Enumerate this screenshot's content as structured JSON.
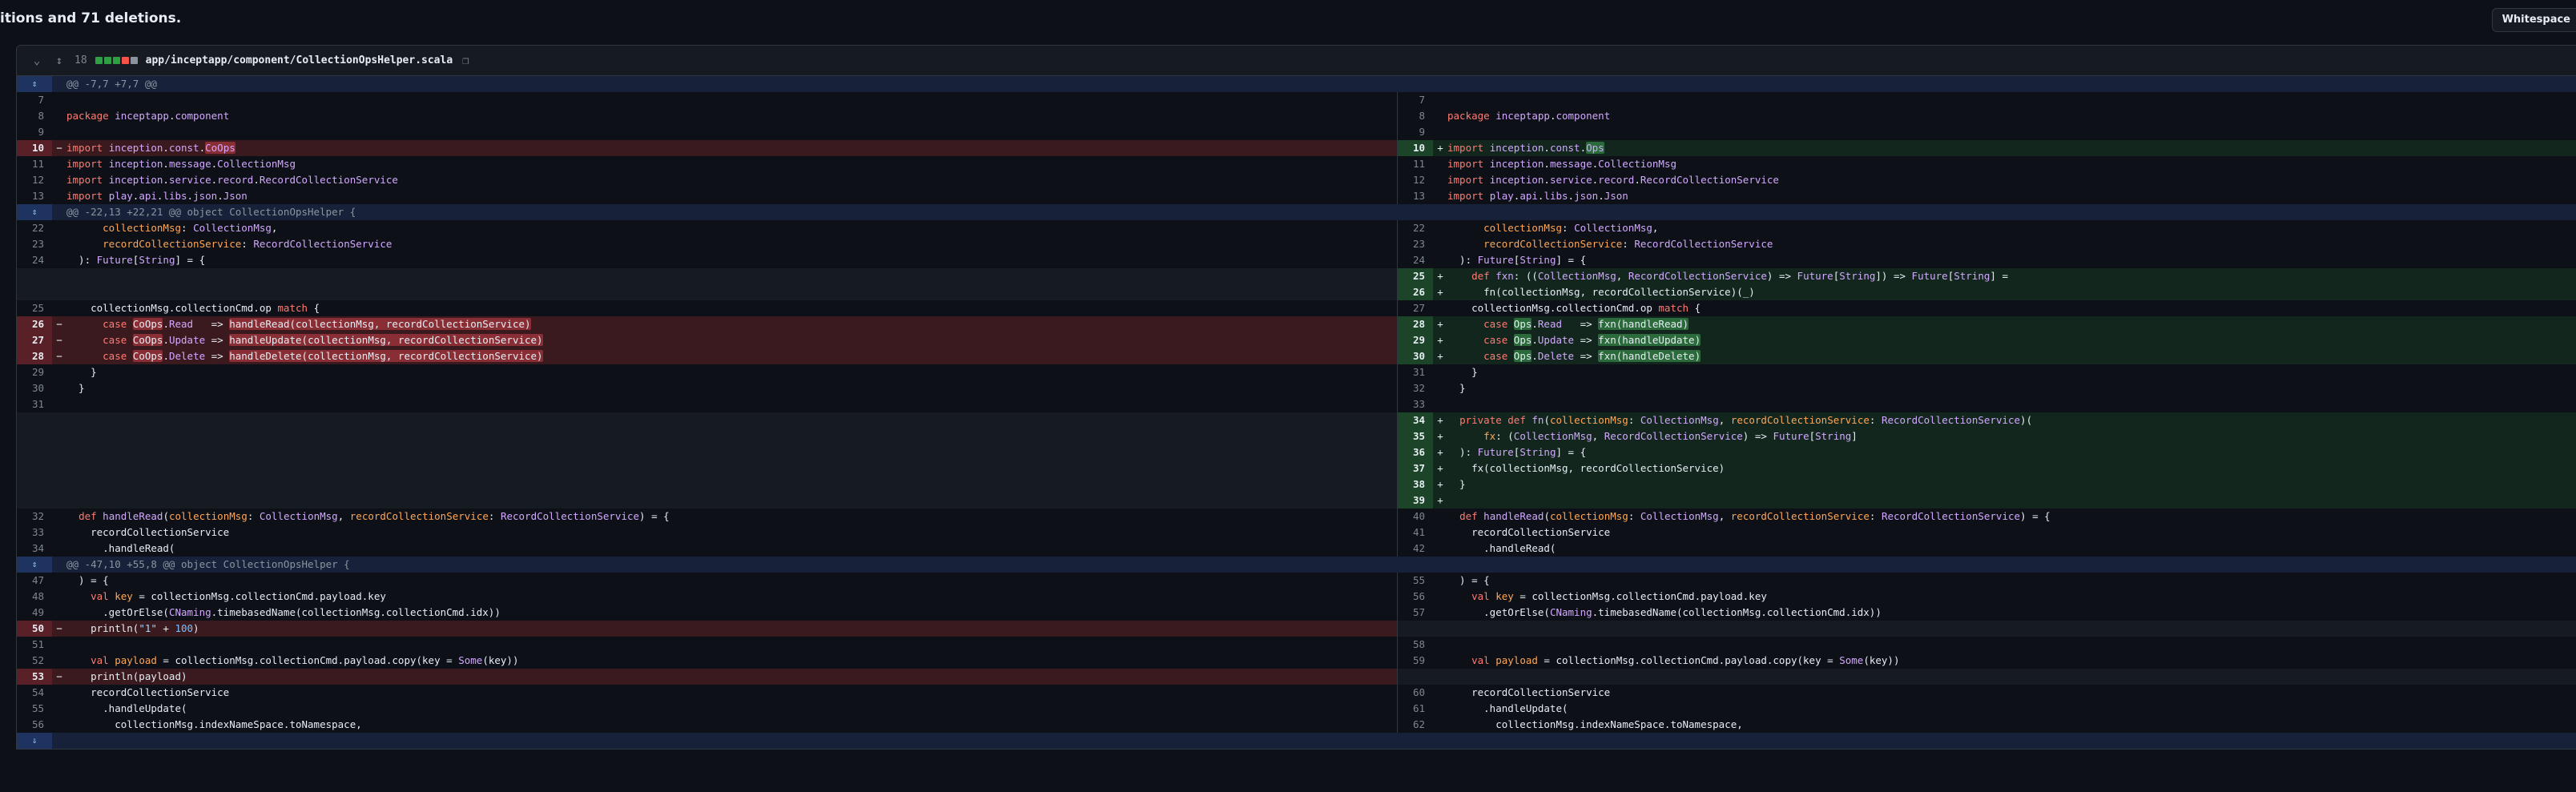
{
  "summary": "itions and 71 deletions.",
  "whitespace_button": "Whitespace",
  "file": {
    "change_count": "18",
    "path": "app/inceptapp/component/CollectionOpsHelper.scala",
    "bar_colors": [
      "#2ea043",
      "#2ea043",
      "#2ea043",
      "#f85149",
      "#8b949e"
    ]
  },
  "icons": {
    "chevron": "chevron-down-icon",
    "expand": "unfold-icon",
    "copy": "copy-icon"
  },
  "hunks": [
    "@@ -7,7 +7,7 @@",
    "@@ -22,13 +22,21 @@ object CollectionOpsHelper {",
    "@@ -47,10 +55,8 @@ object CollectionOpsHelper {"
  ],
  "rows": [
    {
      "t": "hunk",
      "h": 0
    },
    {
      "t": "n",
      "l": "7",
      "r": "7",
      "c": ""
    },
    {
      "t": "n",
      "l": "8",
      "r": "8",
      "c": "<span class='kw'>package</span> <span class='ty'>inceptapp</span>.<span class='ty'>component</span>"
    },
    {
      "t": "n",
      "l": "9",
      "r": "9",
      "c": ""
    },
    {
      "t": "dl",
      "l": "10",
      "r": "10",
      "lc": "<span class='kw'>import</span> <span class='ty'>inception</span>.<span class='ty'>const</span>.<span class='hd ty'>CoOps</span>",
      "rc": "<span class='kw'>import</span> <span class='ty'>inception</span>.<span class='ty'>const</span>.<span class='ha ty'>Ops</span>"
    },
    {
      "t": "n",
      "l": "11",
      "r": "11",
      "c": "<span class='kw'>import</span> <span class='ty'>inception</span>.<span class='ty'>message</span>.<span class='ty'>CollectionMsg</span>"
    },
    {
      "t": "n",
      "l": "12",
      "r": "12",
      "c": "<span class='kw'>import</span> <span class='ty'>inception</span>.<span class='ty'>service</span>.<span class='ty'>record</span>.<span class='ty'>RecordCollectionService</span>"
    },
    {
      "t": "n",
      "l": "13",
      "r": "13",
      "c": "<span class='kw'>import</span> <span class='ty'>play</span>.<span class='ty'>api</span>.<span class='ty'>libs</span>.<span class='ty'>json</span>.<span class='ty'>Json</span>"
    },
    {
      "t": "hunk",
      "h": 1
    },
    {
      "t": "n",
      "l": "22",
      "r": "22",
      "c": "      <span class='pm'>collectionMsg</span>: <span class='ty'>CollectionMsg</span>,"
    },
    {
      "t": "n",
      "l": "23",
      "r": "23",
      "c": "      <span class='pm'>recordCollectionService</span>: <span class='ty'>RecordCollectionService</span>"
    },
    {
      "t": "n",
      "l": "24",
      "r": "24",
      "c": "  ): <span class='ty'>Future</span>[<span class='ty'>String</span>] = {"
    },
    {
      "t": "ar",
      "r": "25",
      "rc": "    <span class='kw'>def</span> <span class='fn'>fxn</span>: ((<span class='ty'>CollectionMsg</span>, <span class='ty'>RecordCollectionService</span>) => <span class='ty'>Future</span>[<span class='ty'>String</span>]) => <span class='ty'>Future</span>[<span class='ty'>String</span>] ="
    },
    {
      "t": "ar",
      "r": "26",
      "rc": "      fn(collectionMsg, recordCollectionService)(_)"
    },
    {
      "t": "n",
      "l": "25",
      "r": "27",
      "c": "    collectionMsg.collectionCmd.op <span class='kw'>match</span> {"
    },
    {
      "t": "dl",
      "l": "26",
      "r": "28",
      "lc": "      <span class='kw'>case</span> <span class='hd'>CoOps</span>.<span class='ty'>Read</span>   => <span class='hd'>handleRead(collectionMsg, recordCollectionService)</span>",
      "rc": "      <span class='kw'>case</span> <span class='ha'>Ops</span>.<span class='ty'>Read</span>   => <span class='ha'>fxn(handleRead)</span>"
    },
    {
      "t": "dl",
      "l": "27",
      "r": "29",
      "lc": "      <span class='kw'>case</span> <span class='hd'>CoOps</span>.<span class='ty'>Update</span> => <span class='hd'>handleUpdate(collectionMsg, recordCollectionService)</span>",
      "rc": "      <span class='kw'>case</span> <span class='ha'>Ops</span>.<span class='ty'>Update</span> => <span class='ha'>fxn(handleUpdate)</span>"
    },
    {
      "t": "dl",
      "l": "28",
      "r": "30",
      "lc": "      <span class='kw'>case</span> <span class='hd'>CoOps</span>.<span class='ty'>Delete</span> => <span class='hd'>handleDelete(collectionMsg, recordCollectionService)</span>",
      "rc": "      <span class='kw'>case</span> <span class='ha'>Ops</span>.<span class='ty'>Delete</span> => <span class='ha'>fxn(handleDelete)</span>"
    },
    {
      "t": "n",
      "l": "29",
      "r": "31",
      "c": "    }"
    },
    {
      "t": "n",
      "l": "30",
      "r": "32",
      "c": "  }"
    },
    {
      "t": "n",
      "l": "31",
      "r": "33",
      "c": ""
    },
    {
      "t": "ar",
      "r": "34",
      "rc": "  <span class='kw'>private</span> <span class='kw'>def</span> <span class='fn'>fn</span>(<span class='pm'>collectionMsg</span>: <span class='ty'>CollectionMsg</span>, <span class='pm'>recordCollectionService</span>: <span class='ty'>RecordCollectionService</span>)("
    },
    {
      "t": "ar",
      "r": "35",
      "rc": "      <span class='pm'>fx</span>: (<span class='ty'>CollectionMsg</span>, <span class='ty'>RecordCollectionService</span>) => <span class='ty'>Future</span>[<span class='ty'>String</span>]"
    },
    {
      "t": "ar",
      "r": "36",
      "rc": "  ): <span class='ty'>Future</span>[<span class='ty'>String</span>] = {"
    },
    {
      "t": "ar",
      "r": "37",
      "rc": "    fx(collectionMsg, recordCollectionService)"
    },
    {
      "t": "ar",
      "r": "38",
      "rc": "  }"
    },
    {
      "t": "ar",
      "r": "39",
      "rc": ""
    },
    {
      "t": "n",
      "l": "32",
      "r": "40",
      "c": "  <span class='kw'>def</span> <span class='fn'>handleRead</span>(<span class='pm'>collectionMsg</span>: <span class='ty'>CollectionMsg</span>, <span class='pm'>recordCollectionService</span>: <span class='ty'>RecordCollectionService</span>) = {"
    },
    {
      "t": "n",
      "l": "33",
      "r": "41",
      "c": "    recordCollectionService"
    },
    {
      "t": "n",
      "l": "34",
      "r": "42",
      "c": "      .handleRead("
    },
    {
      "t": "hunk",
      "h": 2
    },
    {
      "t": "n",
      "l": "47",
      "r": "55",
      "c": "  ) = {"
    },
    {
      "t": "n",
      "l": "48",
      "r": "56",
      "c": "    <span class='kw'>val</span> <span class='pm'>key</span> = collectionMsg.collectionCmd.payload.key"
    },
    {
      "t": "n",
      "l": "49",
      "r": "57",
      "c": "      .getOrElse(<span class='ty'>CNaming</span>.timebasedName(collectionMsg.collectionCmd.idx))"
    },
    {
      "t": "dl",
      "l": "50",
      "lc": "    println(<span class='st'>\"1\"</span> + <span class='nu'>100</span>)",
      "rc": ""
    },
    {
      "t": "n",
      "l": "51",
      "r": "58",
      "c": ""
    },
    {
      "t": "n",
      "l": "52",
      "r": "59",
      "c": "    <span class='kw'>val</span> <span class='pm'>payload</span> = collectionMsg.collectionCmd.payload.copy(key = <span class='ty'>Some</span>(key))"
    },
    {
      "t": "dl",
      "l": "53",
      "lc": "    println(payload)",
      "rc": ""
    },
    {
      "t": "n",
      "l": "54",
      "r": "60",
      "c": "    recordCollectionService"
    },
    {
      "t": "n",
      "l": "55",
      "r": "61",
      "c": "      .handleUpdate("
    },
    {
      "t": "n",
      "l": "56",
      "r": "62",
      "c": "        collectionMsg.indexNameSpace.toNamespace,"
    },
    {
      "t": "foot"
    }
  ]
}
